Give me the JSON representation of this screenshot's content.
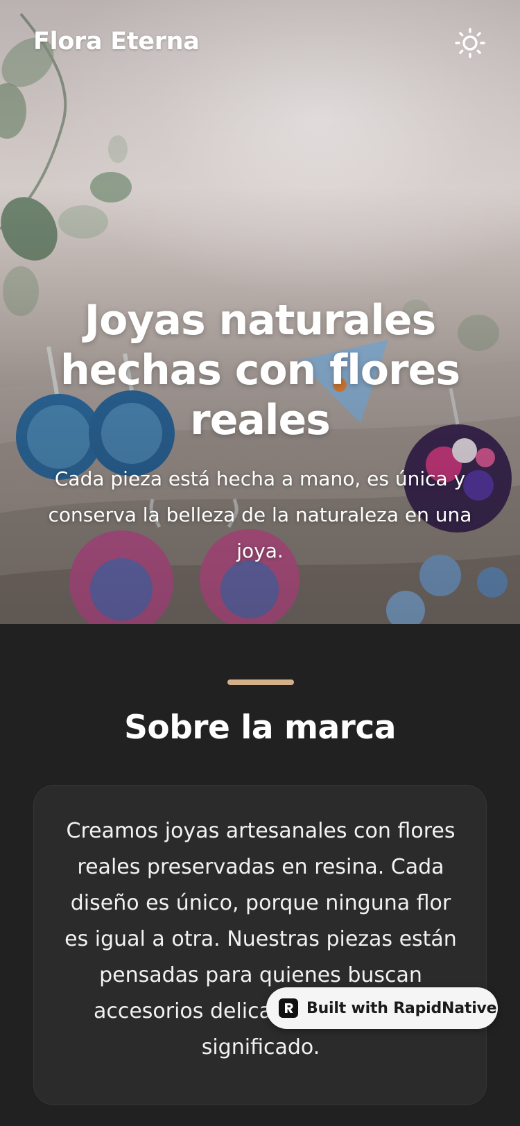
{
  "header": {
    "brand": "Flora Eterna",
    "theme_toggle_icon": "sun-icon"
  },
  "hero": {
    "title": "Joyas naturales hechas con flores reales",
    "subtitle": "Cada pieza está hecha a mano, es única y conserva la belleza de la naturaleza en una joya.",
    "image": "flower-resin-jewelry-photo"
  },
  "about": {
    "title": "Sobre la marca",
    "body": "Creamos joyas artesanales con flores reales preservadas en resina. Cada diseño es único, porque ninguna flor es igual a otra. Nuestras piezas están pensadas para quienes buscan accesorios delicados y llenos de significado."
  },
  "badge": {
    "label": "Built with RapidNative",
    "icon": "rapidnative-logo-icon"
  },
  "colors": {
    "background": "#212121",
    "card": "#2b2b2b",
    "accent": "#d3b08a",
    "text": "#ffffff",
    "badge_bg": "#f5f5f5"
  }
}
